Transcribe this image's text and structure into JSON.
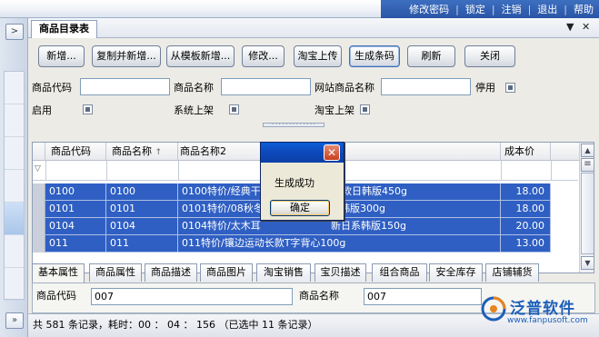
{
  "topbar": {
    "links": [
      "修改密码",
      "锁定",
      "注销",
      "退出",
      "帮助"
    ]
  },
  "leftstrip": {
    "top_button": ">",
    "bottom_button": "»"
  },
  "window": {
    "tab_title": "商品目录表",
    "dropdown_icon": "▼",
    "close_icon": "✕"
  },
  "toolbar": {
    "buttons": [
      "新增...",
      "复制并新增...",
      "从模板新增...",
      "修改...",
      "淘宝上传",
      "生成条码",
      "刷新",
      "关闭"
    ]
  },
  "filters": {
    "product_code_label": "商品代码",
    "product_name_label": "商品名称",
    "web_product_name_label": "网站商品名称",
    "disabled_label": "停用",
    "enabled_label": "启用",
    "system_listed_label": "系统上架",
    "taobao_listed_label": "淘宝上架",
    "product_code_value": "",
    "product_name_value": "",
    "web_product_name_value": ""
  },
  "grid": {
    "columns": [
      "商品代码",
      "商品名称",
      "商品名称2",
      "成本价"
    ],
    "sort_icon": "↑",
    "filter_icon": "▽",
    "rows": [
      {
        "code": "0100",
        "name": "0100",
        "name2": "0100特价/经典干",
        "name2_tail": "季新款日韩版450g",
        "cost": "18.00"
      },
      {
        "code": "0101",
        "name": "0101",
        "name2": "0101特价/08秋冬",
        "name2_tail": "韩版300g",
        "cost": "18.00"
      },
      {
        "code": "0104",
        "name": "0104",
        "name2": "0104特价/太木耳",
        "name2_tail": "新日系韩版150g",
        "cost": "20.00"
      },
      {
        "code": "011",
        "name": "011",
        "name2": "011特价/镶边运动长款T字背心100g",
        "name2_tail": "",
        "cost": "13.00"
      }
    ]
  },
  "bottom_tabs": [
    "基本属性",
    "商品属性",
    "商品描述",
    "商品图片",
    "淘宝销售",
    "宝贝描述",
    "组合商品",
    "安全库存",
    "店铺辅货"
  ],
  "detail": {
    "code_label": "商品代码",
    "code_value": "007",
    "name_label": "商品名称",
    "name_value": "007"
  },
  "status": {
    "text": "共 581 条记录，耗时：00 ： 04 ： 156 （已选中 11 条记录）"
  },
  "dialog": {
    "message": "生成成功",
    "ok_label": "确定",
    "close_icon": "✕"
  },
  "logo": {
    "name": "泛普软件",
    "url": "www.fanpusoft.com"
  },
  "colors": {
    "selection_blue": "#2f5fc3",
    "topbar_blue": "#2f5cae",
    "logo_blue": "#1d5fb8"
  }
}
